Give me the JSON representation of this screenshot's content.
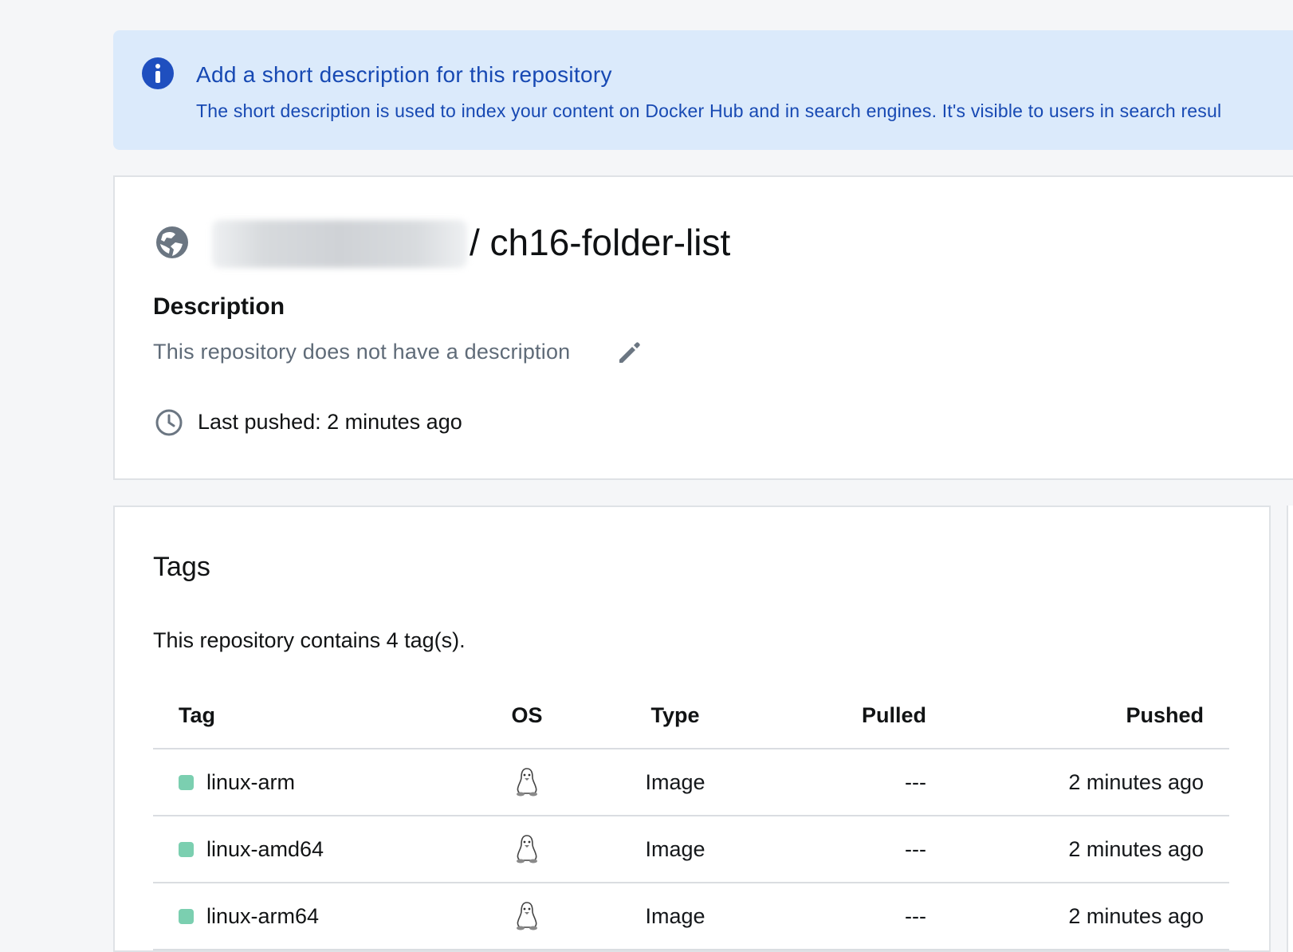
{
  "banner": {
    "title": "Add a short description for this repository",
    "body": "The short description is used to index your content on Docker Hub and in search engines. It's visible to users in search resul",
    "icon": "info-icon",
    "color": "#1749b3"
  },
  "repo": {
    "visibility_icon": "globe-icon",
    "name": "/ ch16-folder-list",
    "description_label": "Description",
    "description_text": "This repository does not have a description",
    "last_pushed": "Last pushed: 2 minutes ago"
  },
  "tags": {
    "title": "Tags",
    "count_text": "This repository contains 4 tag(s).",
    "columns": {
      "tag": "Tag",
      "os": "OS",
      "type": "Type",
      "pulled": "Pulled",
      "pushed": "Pushed"
    },
    "rows": [
      {
        "tag": "linux-arm",
        "os_icon": "linux-icon",
        "type": "Image",
        "pulled": "---",
        "pushed": "2 minutes ago"
      },
      {
        "tag": "linux-amd64",
        "os_icon": "linux-icon",
        "type": "Image",
        "pulled": "---",
        "pushed": "2 minutes ago"
      },
      {
        "tag": "linux-arm64",
        "os_icon": "linux-icon",
        "type": "Image",
        "pulled": "---",
        "pushed": "2 minutes ago"
      }
    ],
    "status_color": "#7bcfb0"
  }
}
